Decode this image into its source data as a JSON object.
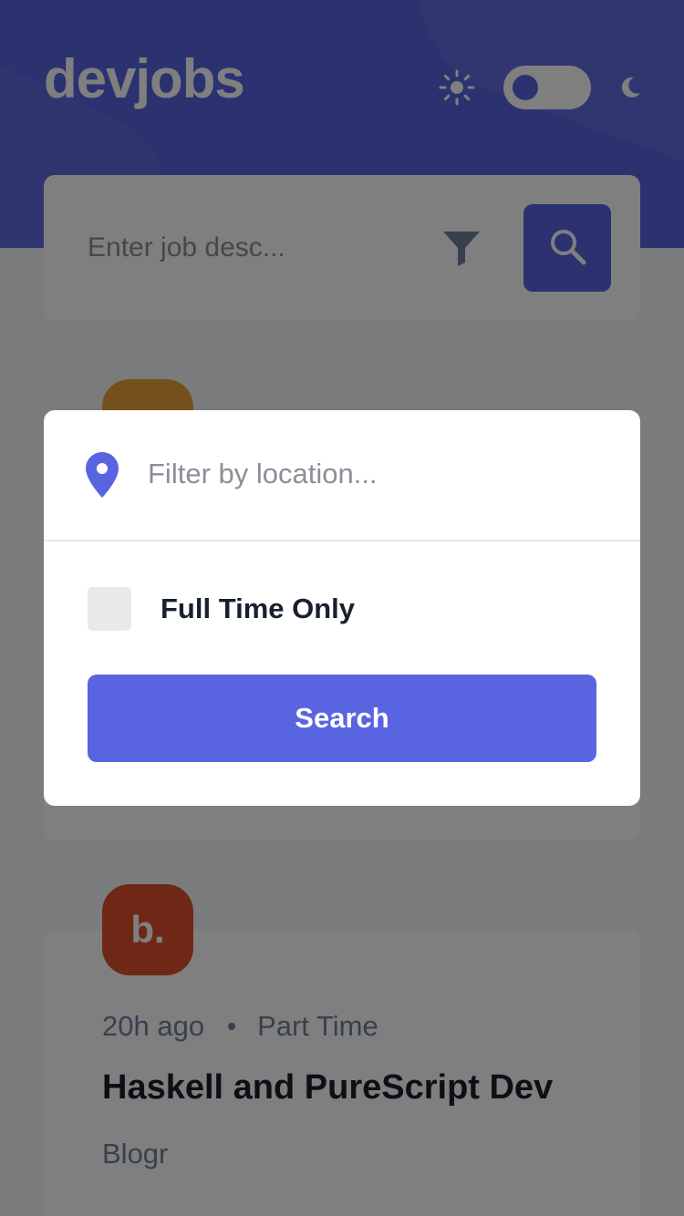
{
  "app": {
    "logo": "devjobs"
  },
  "header": {
    "icons": {
      "sun": "sun-icon",
      "moon": "moon-icon"
    },
    "theme_toggle": {
      "state": "light"
    }
  },
  "search": {
    "placeholder": "Enter job desc...",
    "filter_icon": "filter-icon",
    "search_icon": "search-icon"
  },
  "jobs": [
    {
      "logo_text": "",
      "logo_color": "#e8a03a"
    },
    {
      "logo_text": "b.",
      "logo_color": "#e0502d",
      "posted": "20h ago",
      "type": "Part Time",
      "title": "Haskell and PureScript Dev",
      "company": "Blogr"
    }
  ],
  "filter_modal": {
    "location_placeholder": "Filter by location...",
    "location_icon": "location-pin-icon",
    "fulltime_label": "Full Time Only",
    "fulltime_checked": false,
    "search_button": "Search"
  },
  "colors": {
    "accent": "#5964e0",
    "text_dark": "#19202d",
    "text_muted": "#6e8098",
    "background": "#f4f6f8"
  }
}
